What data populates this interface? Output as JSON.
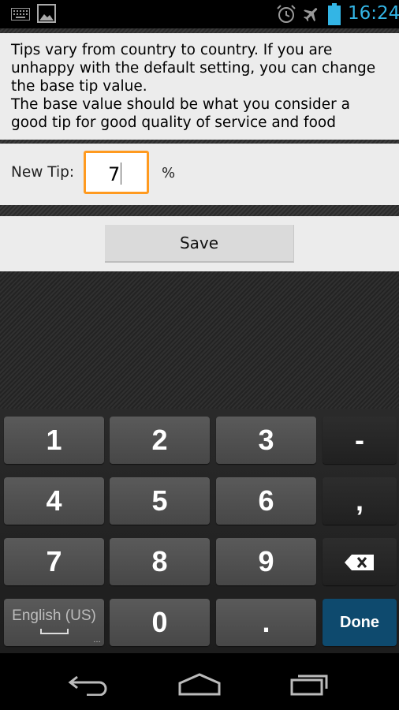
{
  "status": {
    "time": "16:24"
  },
  "info": {
    "line1": "Tips vary from country to country. If you are unhappy with the default setting, you can change the base tip value.",
    "line2": "The base value should be what you consider a good tip for good quality of service and food"
  },
  "form": {
    "new_tip_label": "New Tip:",
    "tip_value": "7",
    "unit": "%"
  },
  "save": {
    "label": "Save"
  },
  "keyboard": {
    "keys": [
      "1",
      "2",
      "3",
      "-",
      "4",
      "5",
      "6",
      ",",
      "7",
      "8",
      "9",
      "0",
      "."
    ],
    "language": "English (US)",
    "done": "Done"
  },
  "colors": {
    "accent": "#33b5e5",
    "focus": "#ff9a1f",
    "done": "#0e4a6e"
  }
}
